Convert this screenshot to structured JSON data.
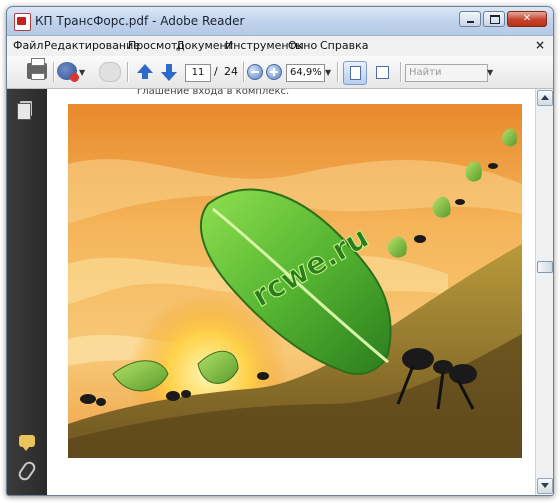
{
  "window": {
    "title": "КП ТрансФорс.pdf - Adobe Reader"
  },
  "menu": {
    "items": [
      "Файл",
      "Редактирование",
      "Просмотр",
      "Документ",
      "Инструменты",
      "Окно",
      "Справка"
    ],
    "close_glyph": "×"
  },
  "toolbar": {
    "current_page": "11",
    "page_separator": "/",
    "total_pages": "24",
    "zoom_value": "64,9%",
    "search_placeholder": "Найти",
    "dropdown_glyph": "▼"
  },
  "document": {
    "cut_text": "глашение входа в комплекс.",
    "watermark_text": "rcwe.ru"
  },
  "colors": {
    "accent_blue": "#2c6bc9",
    "leaf_green": "#56b532",
    "sky_orange": "#f2a23a"
  }
}
